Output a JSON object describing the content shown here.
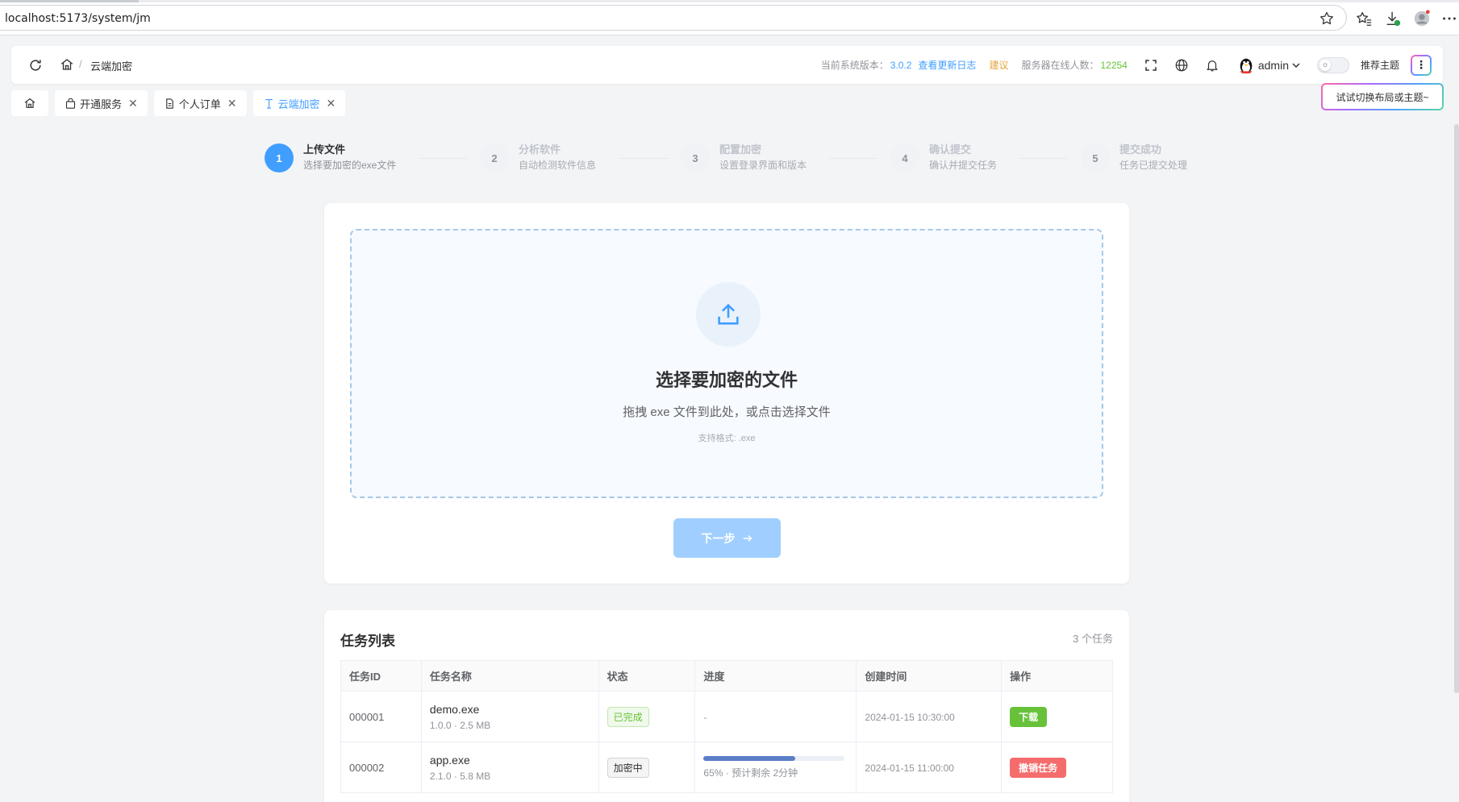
{
  "browser": {
    "url": "localhost:5173/system/jm"
  },
  "header": {
    "breadcrumb_current": "云端加密",
    "breadcrumb_sep": "/",
    "version_label": "当前系统版本：",
    "version": "3.0.2",
    "changelog_link": "查看更新日志",
    "suggest_link": "建议",
    "online_label": "服务器在线人数：",
    "online_count": "12254",
    "username": "admin",
    "recommend_theme": "推荐主题",
    "more_label": "⋮",
    "tooltip": "试试切换布局或主题~"
  },
  "tabs": [
    {
      "label": "开通服务",
      "icon": "bag-icon"
    },
    {
      "label": "个人订单",
      "icon": "document-icon"
    },
    {
      "label": "云端加密",
      "icon": "upload-text-icon",
      "active": true
    }
  ],
  "steps": [
    {
      "num": "1",
      "title": "上传文件",
      "desc": "选择要加密的exe文件",
      "active": true
    },
    {
      "num": "2",
      "title": "分析软件",
      "desc": "自动检测软件信息"
    },
    {
      "num": "3",
      "title": "配置加密",
      "desc": "设置登录界面和版本"
    },
    {
      "num": "4",
      "title": "确认提交",
      "desc": "确认并提交任务"
    },
    {
      "num": "5",
      "title": "提交成功",
      "desc": "任务已提交处理"
    }
  ],
  "upload": {
    "title": "选择要加密的文件",
    "subtitle": "拖拽 exe 文件到此处，或点击选择文件",
    "formats": "支持格式: .exe",
    "next_button": "下一步"
  },
  "tasks": {
    "title": "任务列表",
    "count": "3 个任务",
    "columns": [
      "任务ID",
      "任务名称",
      "状态",
      "进度",
      "创建时间",
      "操作"
    ],
    "rows": [
      {
        "id": "000001",
        "name": "demo.exe",
        "meta": "1.0.0 · 2.5 MB",
        "status": "已完成",
        "progress_text": "-",
        "created": "2024-01-15 10:30:00",
        "action": "下载"
      },
      {
        "id": "000002",
        "name": "app.exe",
        "meta": "2.1.0 · 5.8 MB",
        "status": "加密中",
        "progress": 0.65,
        "progress_text": "65% · 预计剩余 2分钟",
        "created": "2024-01-15 11:00:00",
        "action": "撤销任务"
      }
    ]
  },
  "colors": {
    "primary": "#409eff",
    "success": "#67c23a",
    "warning": "#e6a23c",
    "danger": "#f56c6c",
    "progress": "#5b7ec8"
  }
}
